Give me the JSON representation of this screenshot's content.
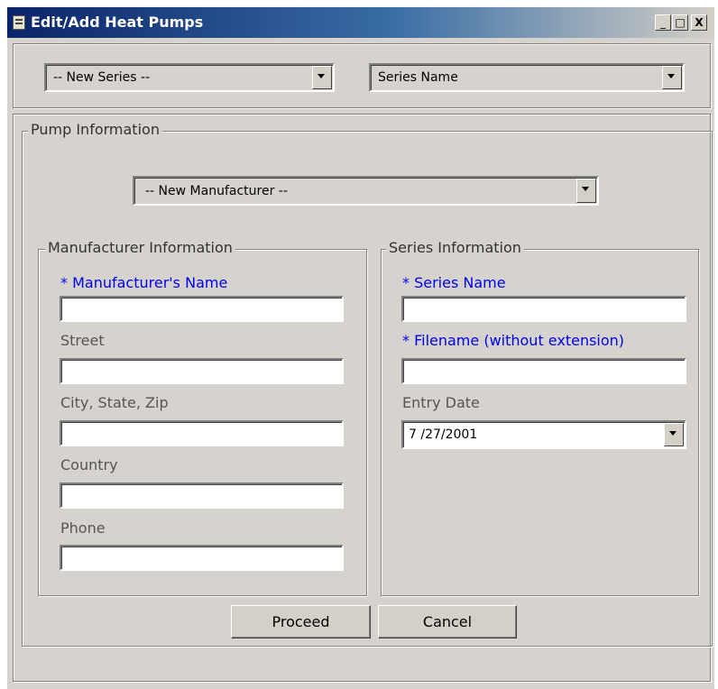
{
  "window": {
    "title": "Edit/Add Heat Pumps",
    "controls": {
      "minimize": "_",
      "maximize": "□",
      "close": "X"
    }
  },
  "top_bar": {
    "series_select": "-- New Series --",
    "series_name_select": "Series Name"
  },
  "pump_info": {
    "legend": "Pump Information",
    "manufacturer_select": "-- New Manufacturer --",
    "manufacturer_group": {
      "legend": "Manufacturer Information",
      "fields": [
        {
          "label": "* Manufacturer's Name",
          "value": ""
        },
        {
          "label": "Street",
          "value": ""
        },
        {
          "label": "City, State, Zip",
          "value": ""
        },
        {
          "label": "Country",
          "value": ""
        },
        {
          "label": "Phone",
          "value": ""
        }
      ]
    },
    "series_group": {
      "legend": "Series Information",
      "series_name_label": "* Series Name",
      "series_name_value": "",
      "filename_label": "* Filename (without extension)",
      "filename_value": "",
      "entry_date_label": "Entry Date",
      "entry_date_value": "7 /27/2001"
    }
  },
  "buttons": {
    "proceed": "Proceed",
    "cancel": "Cancel"
  },
  "colors": {
    "required_label": "#0000ee",
    "window_bg": "#d6d3ce",
    "title_bar": "#0a246a"
  }
}
